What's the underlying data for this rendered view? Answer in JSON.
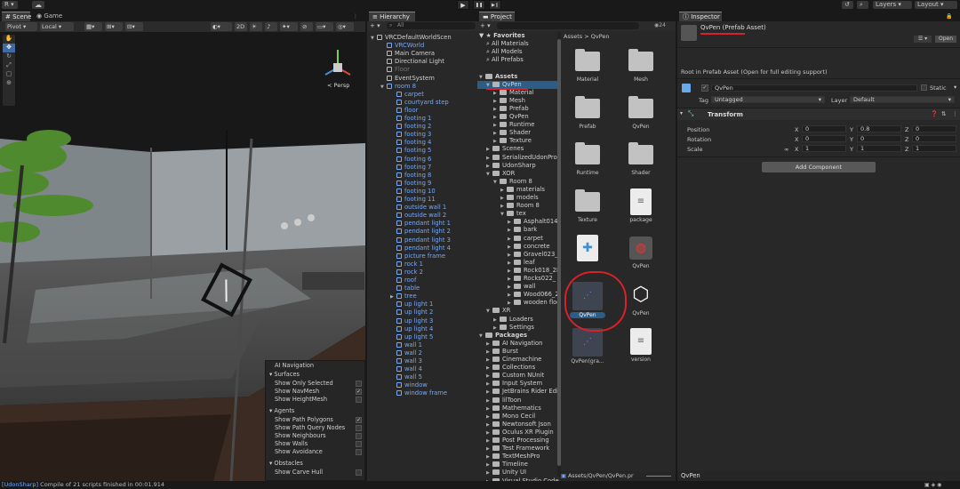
{
  "topbar": {
    "account": "R",
    "account_caret": "▾",
    "cloud": "☁",
    "layers": "Layers",
    "layout": "Layout",
    "history_icon": "↺",
    "search_icon": "⌕",
    "play": "▶",
    "pause": "❚❚",
    "step": "▶❙"
  },
  "tabs": {
    "scene": "Scene",
    "game": "Game",
    "hierarchy": "Hierarchy",
    "project": "Project",
    "inspector": "Inspector"
  },
  "scene_toolbar": {
    "pivot": "Pivot",
    "local": "Local",
    "mode_2d": "2D",
    "persp": "< Persp"
  },
  "hierarchy": {
    "add": "+ ▾",
    "search_placeholder": "All",
    "items": [
      {
        "label": "VRCDefaultWorldScen",
        "level": 0,
        "kind": "scene"
      },
      {
        "label": "VRCWorld",
        "level": 1,
        "kind": "prefab"
      },
      {
        "label": "Main Camera",
        "level": 1,
        "kind": "obj"
      },
      {
        "label": "Directional Light",
        "level": 1,
        "kind": "obj"
      },
      {
        "label": "Floor",
        "level": 1,
        "kind": "grey"
      },
      {
        "label": "EventSystem",
        "level": 1,
        "kind": "obj"
      },
      {
        "label": "room 8",
        "level": 1,
        "kind": "prefab"
      },
      {
        "label": "carpet",
        "level": 2,
        "kind": "prefab"
      },
      {
        "label": "courtyard step",
        "level": 2,
        "kind": "prefab"
      },
      {
        "label": "floor",
        "level": 2,
        "kind": "prefab"
      },
      {
        "label": "footing 1",
        "level": 2,
        "kind": "prefab"
      },
      {
        "label": "footing 2",
        "level": 2,
        "kind": "prefab"
      },
      {
        "label": "footing 3",
        "level": 2,
        "kind": "prefab"
      },
      {
        "label": "footing 4",
        "level": 2,
        "kind": "prefab"
      },
      {
        "label": "footing 5",
        "level": 2,
        "kind": "prefab"
      },
      {
        "label": "footing 6",
        "level": 2,
        "kind": "prefab"
      },
      {
        "label": "footing 7",
        "level": 2,
        "kind": "prefab"
      },
      {
        "label": "footing 8",
        "level": 2,
        "kind": "prefab"
      },
      {
        "label": "footing 9",
        "level": 2,
        "kind": "prefab"
      },
      {
        "label": "footing 10",
        "level": 2,
        "kind": "prefab"
      },
      {
        "label": "footing 11",
        "level": 2,
        "kind": "prefab"
      },
      {
        "label": "outside wall 1",
        "level": 2,
        "kind": "prefab"
      },
      {
        "label": "outside wall 2",
        "level": 2,
        "kind": "prefab"
      },
      {
        "label": "pendant light 1",
        "level": 2,
        "kind": "prefab"
      },
      {
        "label": "pendant light 2",
        "level": 2,
        "kind": "prefab"
      },
      {
        "label": "pendant light 3",
        "level": 2,
        "kind": "prefab"
      },
      {
        "label": "pendant light 4",
        "level": 2,
        "kind": "prefab"
      },
      {
        "label": "picture frame",
        "level": 2,
        "kind": "prefab"
      },
      {
        "label": "rock 1",
        "level": 2,
        "kind": "prefab"
      },
      {
        "label": "rock 2",
        "level": 2,
        "kind": "prefab"
      },
      {
        "label": "roof",
        "level": 2,
        "kind": "prefab"
      },
      {
        "label": "table",
        "level": 2,
        "kind": "prefab"
      },
      {
        "label": "tree",
        "level": 2,
        "kind": "prefab"
      },
      {
        "label": "up light 1",
        "level": 2,
        "kind": "prefab"
      },
      {
        "label": "up light 2",
        "level": 2,
        "kind": "prefab"
      },
      {
        "label": "up light 3",
        "level": 2,
        "kind": "prefab"
      },
      {
        "label": "up light 4",
        "level": 2,
        "kind": "prefab"
      },
      {
        "label": "up light 5",
        "level": 2,
        "kind": "prefab"
      },
      {
        "label": "wall 1",
        "level": 2,
        "kind": "prefab"
      },
      {
        "label": "wall 2",
        "level": 2,
        "kind": "prefab"
      },
      {
        "label": "wall 3",
        "level": 2,
        "kind": "prefab"
      },
      {
        "label": "wall 4",
        "level": 2,
        "kind": "prefab"
      },
      {
        "label": "wall 5",
        "level": 2,
        "kind": "prefab"
      },
      {
        "label": "window",
        "level": 2,
        "kind": "prefab"
      },
      {
        "label": "window frame",
        "level": 2,
        "kind": "prefab"
      }
    ]
  },
  "project": {
    "add": "+ ▾",
    "count": "24",
    "breadcrumb": "Assets > QvPen",
    "tree": [
      {
        "label": "Favorites",
        "level": 0,
        "bold": true,
        "icon": "star"
      },
      {
        "label": "All Materials",
        "level": 1,
        "icon": "search"
      },
      {
        "label": "All Models",
        "level": 1,
        "icon": "search"
      },
      {
        "label": "All Prefabs",
        "level": 1,
        "icon": "search"
      },
      {
        "label": "",
        "level": 0,
        "icon": "none"
      },
      {
        "label": "Assets",
        "level": 0,
        "bold": true,
        "icon": "folder"
      },
      {
        "label": "QvPen",
        "level": 1,
        "icon": "folder",
        "sel": true
      },
      {
        "label": "Material",
        "level": 2,
        "icon": "folder"
      },
      {
        "label": "Mesh",
        "level": 2,
        "icon": "folder"
      },
      {
        "label": "Prefab",
        "level": 2,
        "icon": "folder"
      },
      {
        "label": "QvPen",
        "level": 2,
        "icon": "folder"
      },
      {
        "label": "Runtime",
        "level": 2,
        "icon": "folder"
      },
      {
        "label": "Shader",
        "level": 2,
        "icon": "folder"
      },
      {
        "label": "Texture",
        "level": 2,
        "icon": "folder"
      },
      {
        "label": "Scenes",
        "level": 1,
        "icon": "folder"
      },
      {
        "label": "SerializedUdonPro",
        "level": 1,
        "icon": "folder"
      },
      {
        "label": "UdonSharp",
        "level": 1,
        "icon": "folder"
      },
      {
        "label": "XOR",
        "level": 1,
        "icon": "folder"
      },
      {
        "label": "Room 8",
        "level": 2,
        "icon": "folder"
      },
      {
        "label": "materials",
        "level": 3,
        "icon": "folder"
      },
      {
        "label": "models",
        "level": 3,
        "icon": "folder"
      },
      {
        "label": "Room 8",
        "level": 3,
        "icon": "folder"
      },
      {
        "label": "tex",
        "level": 3,
        "icon": "folder"
      },
      {
        "label": "Asphalt014",
        "level": 4,
        "icon": "folder"
      },
      {
        "label": "bark",
        "level": 4,
        "icon": "folder"
      },
      {
        "label": "carpet",
        "level": 4,
        "icon": "folder"
      },
      {
        "label": "concrete",
        "level": 4,
        "icon": "folder"
      },
      {
        "label": "Gravel023_",
        "level": 4,
        "icon": "folder"
      },
      {
        "label": "leaf",
        "level": 4,
        "icon": "folder"
      },
      {
        "label": "Rock018_2K",
        "level": 4,
        "icon": "folder"
      },
      {
        "label": "Rocks022_",
        "level": 4,
        "icon": "folder"
      },
      {
        "label": "wall",
        "level": 4,
        "icon": "folder"
      },
      {
        "label": "Wood066_2",
        "level": 4,
        "icon": "folder"
      },
      {
        "label": "wooden floo",
        "level": 4,
        "icon": "folder"
      },
      {
        "label": "XR",
        "level": 1,
        "icon": "folder"
      },
      {
        "label": "Loaders",
        "level": 2,
        "icon": "folder"
      },
      {
        "label": "Settings",
        "level": 2,
        "icon": "folder"
      },
      {
        "label": "Packages",
        "level": 0,
        "bold": true,
        "icon": "folder"
      },
      {
        "label": "AI Navigation",
        "level": 1,
        "icon": "folder"
      },
      {
        "label": "Burst",
        "level": 1,
        "icon": "folder"
      },
      {
        "label": "Cinemachine",
        "level": 1,
        "icon": "folder"
      },
      {
        "label": "Collections",
        "level": 1,
        "icon": "folder"
      },
      {
        "label": "Custom NUnit",
        "level": 1,
        "icon": "folder"
      },
      {
        "label": "Input System",
        "level": 1,
        "icon": "folder"
      },
      {
        "label": "JetBrains Rider Edi",
        "level": 1,
        "icon": "folder"
      },
      {
        "label": "lilToon",
        "level": 1,
        "icon": "folder"
      },
      {
        "label": "Mathematics",
        "level": 1,
        "icon": "folder"
      },
      {
        "label": "Mono Cecil",
        "level": 1,
        "icon": "folder"
      },
      {
        "label": "Newtonsoft Json",
        "level": 1,
        "icon": "folder"
      },
      {
        "label": "Oculus XR Plugin",
        "level": 1,
        "icon": "folder"
      },
      {
        "label": "Post Processing",
        "level": 1,
        "icon": "folder"
      },
      {
        "label": "Test Framework",
        "level": 1,
        "icon": "folder"
      },
      {
        "label": "TextMeshPro",
        "level": 1,
        "icon": "folder"
      },
      {
        "label": "Timeline",
        "level": 1,
        "icon": "folder"
      },
      {
        "label": "Unity UI",
        "level": 1,
        "icon": "folder"
      },
      {
        "label": "Visual Studio Code",
        "level": 1,
        "icon": "folder"
      }
    ],
    "grid": [
      {
        "label": "Material",
        "kind": "folder"
      },
      {
        "label": "Mesh",
        "kind": "folder"
      },
      {
        "label": "Prefab",
        "kind": "folder"
      },
      {
        "label": "QvPen",
        "kind": "folder"
      },
      {
        "label": "Runtime",
        "kind": "folder"
      },
      {
        "label": "Shader",
        "kind": "folder"
      },
      {
        "label": "Texture",
        "kind": "folder"
      },
      {
        "label": "package",
        "kind": "doc"
      },
      {
        "label": "",
        "kind": "puzzle"
      },
      {
        "label": "QvPen",
        "kind": "pen"
      },
      {
        "label": "QvPen",
        "kind": "prefab-sel"
      },
      {
        "label": "QvPen",
        "kind": "unity"
      },
      {
        "label": "QvPen(gra...",
        "kind": "prefab"
      },
      {
        "label": "version",
        "kind": "doc"
      }
    ],
    "footer_path": "Assets/QvPen/QvPen.pr"
  },
  "inspector": {
    "title": "QvPen (Prefab Asset)",
    "open_button": "Open",
    "root_note": "Root in Prefab Asset (Open for full editing support)",
    "object_name": "QvPen",
    "static_label": "Static",
    "tag_label": "Tag",
    "tag_value": "Untagged",
    "layer_label": "Layer",
    "layer_value": "Default",
    "transform_title": "Transform",
    "position_label": "Position",
    "rotation_label": "Rotation",
    "scale_label": "Scale",
    "position": {
      "x": "0",
      "y": "0.8",
      "z": "0"
    },
    "rotation": {
      "x": "0",
      "y": "0",
      "z": "0"
    },
    "scale": {
      "x": "1",
      "y": "1",
      "z": "1"
    },
    "axis_x": "X",
    "axis_y": "Y",
    "axis_z": "Z",
    "add_component": "Add Component",
    "footer_name": "QvPen"
  },
  "ai_navigation": {
    "title": "AI Navigation",
    "surfaces": "Surfaces",
    "show_only_selected": "Show Only Selected",
    "show_navmesh": "Show NavMesh",
    "show_heightmesh": "Show HeightMesh",
    "agents": "Agents",
    "show_path_polygons": "Show Path Polygons",
    "show_path_query_nodes": "Show Path Query Nodes",
    "show_neighbours": "Show Neighbours",
    "show_walls": "Show Walls",
    "show_avoidance": "Show Avoidance",
    "obstacles": "Obstacles",
    "show_carve_hull": "Show Carve Hull",
    "check": "✓"
  },
  "status": {
    "tag": "[UdonSharp]",
    "message": "Compile of 21 scripts finished in 00:01.914"
  },
  "colors": {
    "accent": "#2c5d87",
    "prefab_blue": "#7ba8ef",
    "annotation_red": "#d8212b"
  }
}
